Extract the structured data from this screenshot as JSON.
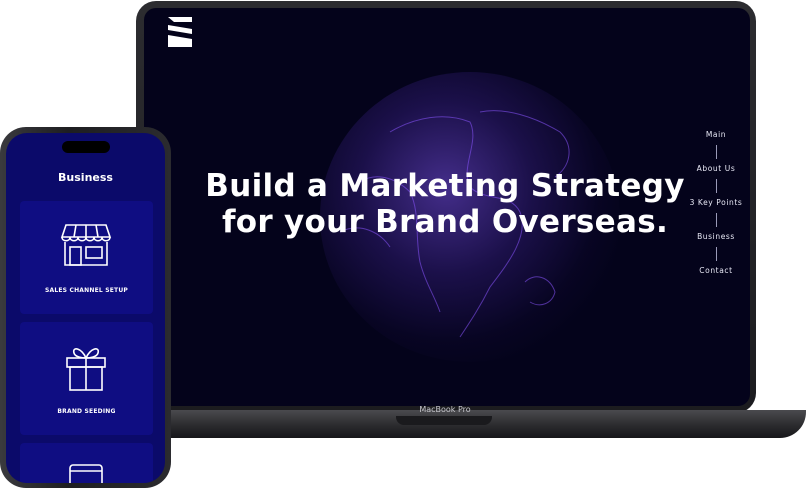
{
  "laptop": {
    "model_label": "MacBook Pro",
    "website": {
      "hero_title_line1": "Build a Marketing Strategy",
      "hero_title_line2": "for your Brand Overseas.",
      "nav": [
        "Main",
        "About Us",
        "3 Key Points",
        "Business",
        "Contact"
      ],
      "colors": {
        "background": "#04031b",
        "globe_glow": "#6a3fd8",
        "text": "#ffffff"
      }
    }
  },
  "phone": {
    "page_title": "Business",
    "cards": [
      {
        "label": "SALES CHANNEL SETUP",
        "icon": "storefront-icon"
      },
      {
        "label": "BRAND SEEDING",
        "icon": "gift-box-icon"
      },
      {
        "label": "",
        "icon": "monitor-icon"
      }
    ],
    "colors": {
      "background": "#0b0a6a",
      "card": "#0f0d82"
    }
  }
}
